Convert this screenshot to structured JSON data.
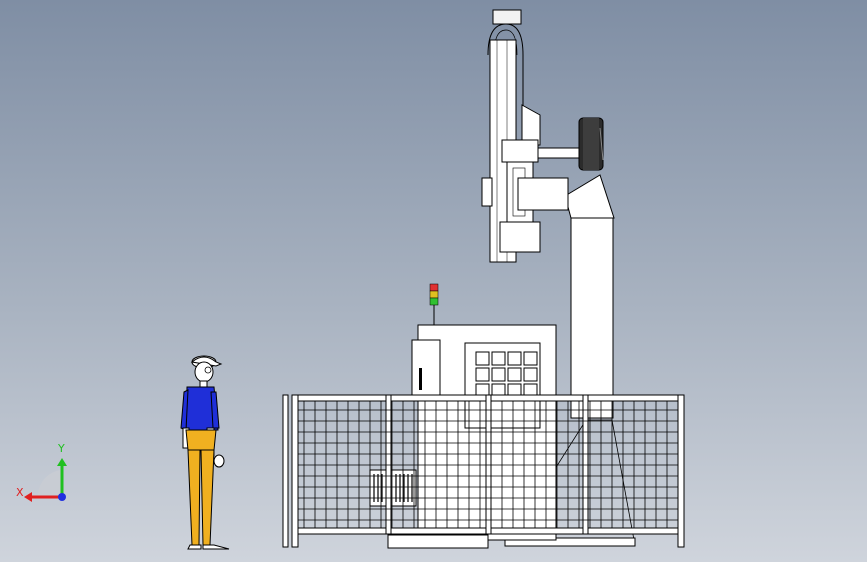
{
  "axes_triad": {
    "x_label": "X",
    "y_label": "Y",
    "x_color": "#e02020",
    "y_color": "#20c020",
    "z_color": "#2030e0"
  },
  "scene": {
    "description_items": [
      "robot-arm",
      "machine-tool",
      "safety-fence",
      "operator-figure",
      "signal-tower"
    ]
  }
}
